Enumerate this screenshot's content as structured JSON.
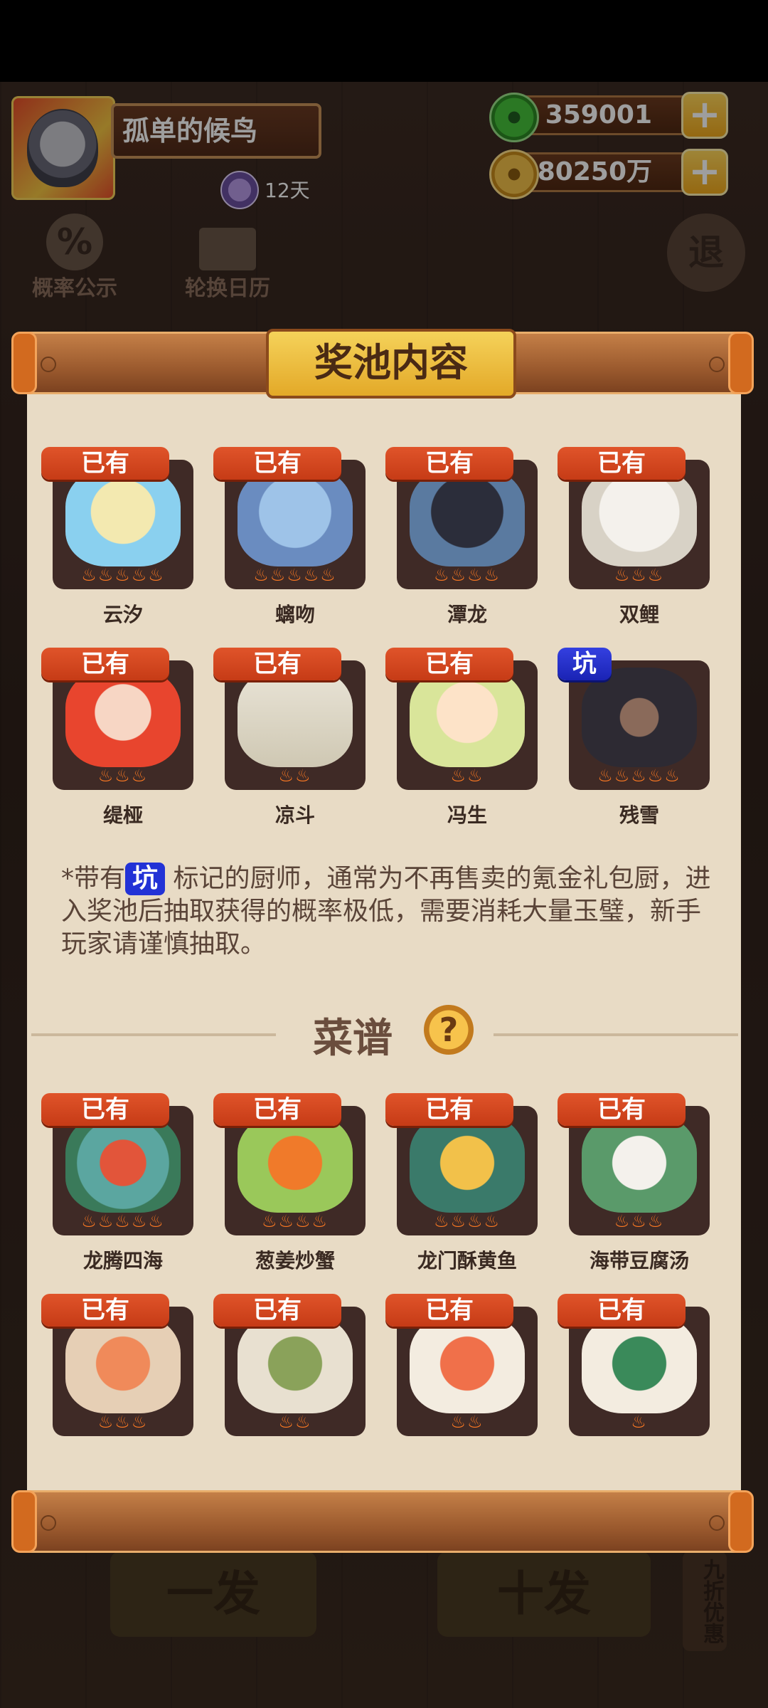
{
  "player": {
    "name": "孤单的候鸟",
    "vip_days": "12天"
  },
  "currency": {
    "jade": "359001",
    "coins": "80250万"
  },
  "side_buttons": {
    "probability": "概率公示",
    "calendar": "轮换日历",
    "exit": "退"
  },
  "panel": {
    "title": "奖池内容"
  },
  "chefs": [
    {
      "name": "云汐",
      "tag": "已有",
      "flames": "♨♨♨♨♨"
    },
    {
      "name": "螭吻",
      "tag": "已有",
      "flames": "♨♨♨♨♨"
    },
    {
      "name": "潭龙",
      "tag": "已有",
      "flames": "♨♨♨♨"
    },
    {
      "name": "双鲤",
      "tag": "已有",
      "flames": "♨♨♨"
    },
    {
      "name": "缇桠",
      "tag": "已有",
      "flames": "♨♨♨"
    },
    {
      "name": "凉斗",
      "tag": "已有",
      "flames": "♨♨"
    },
    {
      "name": "冯生",
      "tag": "已有",
      "flames": "♨♨"
    },
    {
      "name": "残雪",
      "tag": "坑",
      "flames": "♨♨♨♨♨"
    }
  ],
  "note": {
    "prefix": "*带有",
    "pit_label": "坑",
    "text": "标记的厨师，通常为不再售卖的氪金礼包厨，进入奖池后抽取获得的概率极低，需要消耗大量玉璧，新手玩家请谨慎抽取。"
  },
  "menu": {
    "title": "菜谱",
    "help": "?"
  },
  "dishes": [
    {
      "name": "龙腾四海",
      "tag": "已有",
      "flames": "♨♨♨♨♨"
    },
    {
      "name": "葱姜炒蟹",
      "tag": "已有",
      "flames": "♨♨♨♨"
    },
    {
      "name": "龙门酥黄鱼",
      "tag": "已有",
      "flames": "♨♨♨♨"
    },
    {
      "name": "海带豆腐汤",
      "tag": "已有",
      "flames": "♨♨♨"
    },
    {
      "name": "",
      "tag": "已有",
      "flames": "♨♨♨"
    },
    {
      "name": "",
      "tag": "已有",
      "flames": "♨♨"
    },
    {
      "name": "",
      "tag": "已有",
      "flames": "♨♨"
    },
    {
      "name": "",
      "tag": "已有",
      "flames": "♨"
    }
  ],
  "bottom": {
    "single": "一发",
    "ten": "十发",
    "discount": "九折优惠"
  }
}
